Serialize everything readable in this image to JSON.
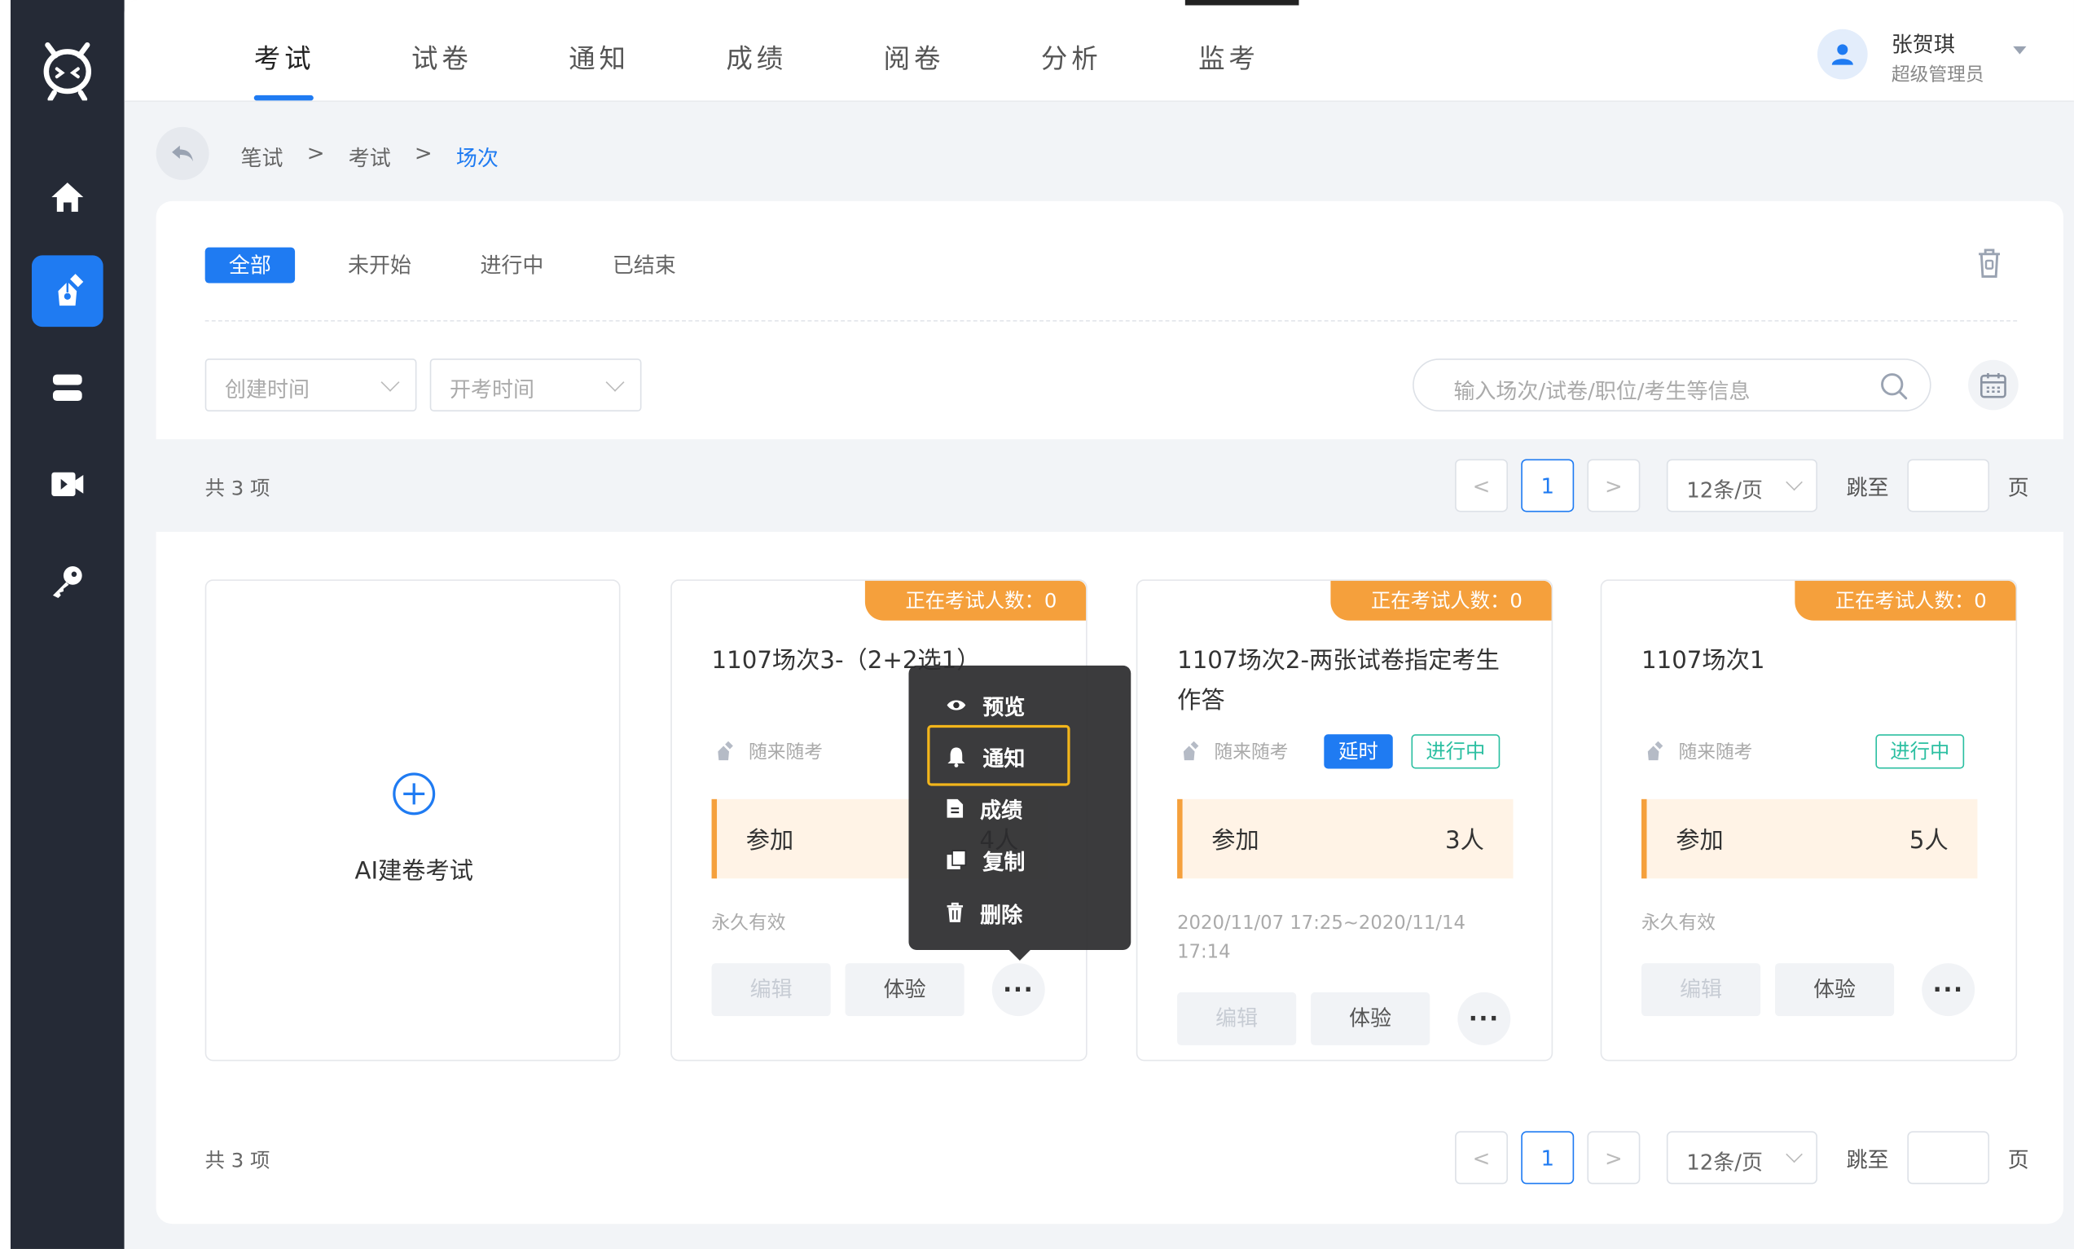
{
  "header": {
    "tabs": [
      {
        "label": "考试",
        "active": true
      },
      {
        "label": "试卷",
        "active": false
      },
      {
        "label": "通知",
        "active": false
      },
      {
        "label": "成绩",
        "active": false
      },
      {
        "label": "阅卷",
        "active": false
      },
      {
        "label": "分析",
        "active": false
      },
      {
        "label": "监考",
        "active": false
      }
    ],
    "user": {
      "name": "张贺琪",
      "role": "超级管理员"
    }
  },
  "sidebar": {
    "items": [
      {
        "icon": "home-icon"
      },
      {
        "icon": "pen-icon",
        "active": true
      },
      {
        "icon": "database-icon"
      },
      {
        "icon": "video-icon"
      },
      {
        "icon": "key-icon"
      }
    ]
  },
  "breadcrumb": {
    "items": [
      "笔试",
      "考试",
      "场次"
    ],
    "separator": ">"
  },
  "filters": {
    "status_tabs": [
      "全部",
      "未开始",
      "进行中",
      "已结束"
    ],
    "active_status": "全部",
    "create_time_placeholder": "创建时间",
    "start_time_placeholder": "开考时间",
    "search_placeholder": "输入场次/试卷/职位/考生等信息"
  },
  "pagination": {
    "total_text": "共 3 项",
    "current_page": "1",
    "page_size": "12条/页",
    "jump_label": "跳至",
    "page_unit": "页",
    "prev": "<",
    "next": ">"
  },
  "add_card": {
    "label": "AI建卷考试"
  },
  "cards": [
    {
      "badge": "正在考试人数：0",
      "title": "1107场次3-（2+2选1）",
      "mode": "随来随考",
      "join_label": "参加",
      "join_count": "4人",
      "validity": "永久有效",
      "edit_label": "编辑",
      "try_label": "体验",
      "more_label": "···"
    },
    {
      "badge": "正在考试人数：0",
      "title": "1107场次2-两张试卷指定考生作答",
      "mode": "随来随考",
      "tag_delay": "延时",
      "tag_status": "进行中",
      "join_label": "参加",
      "join_count": "3人",
      "validity": "2020/11/07 17:25~2020/11/14 17:14",
      "edit_label": "编辑",
      "try_label": "体验",
      "more_label": "···"
    },
    {
      "badge": "正在考试人数：0",
      "title": "1107场次1",
      "mode": "随来随考",
      "tag_status": "进行中",
      "join_label": "参加",
      "join_count": "5人",
      "validity": "永久有效",
      "edit_label": "编辑",
      "try_label": "体验",
      "more_label": "···"
    }
  ],
  "context_menu": {
    "items": [
      {
        "label": "预览",
        "icon": "eye-icon"
      },
      {
        "label": "通知",
        "icon": "bell-icon",
        "highlighted": true
      },
      {
        "label": "成绩",
        "icon": "document-icon"
      },
      {
        "label": "复制",
        "icon": "copy-icon"
      },
      {
        "label": "删除",
        "icon": "trash-icon"
      }
    ]
  },
  "colors": {
    "accent": "#1f7bf2",
    "badge": "#f5a03c",
    "ongoing": "#2bbfa1",
    "highlight": "#f2b51b",
    "sidebar": "#252a36"
  }
}
